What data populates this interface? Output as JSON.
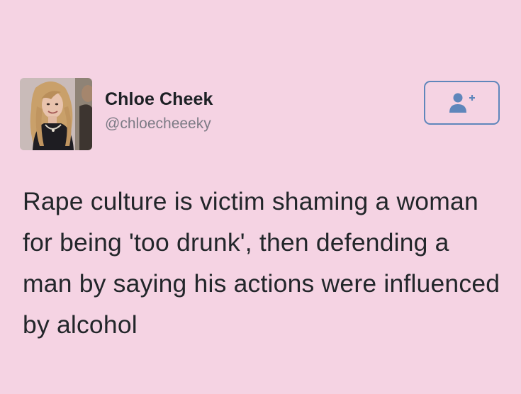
{
  "user": {
    "display_name": "Chloe Cheek",
    "handle": "@chloecheeeky"
  },
  "follow_button": {
    "icon": "follow-user-plus-icon",
    "accent_color": "#5f86bb"
  },
  "tweet": {
    "text": "Rape culture is victim shaming a woman for being 'too drunk', then defending a man by saying his actions were influenced by alcohol"
  },
  "colors": {
    "background": "#f5d3e3",
    "name_text": "#1c2024",
    "handle_text": "#7d7b86",
    "body_text": "#22262a"
  }
}
